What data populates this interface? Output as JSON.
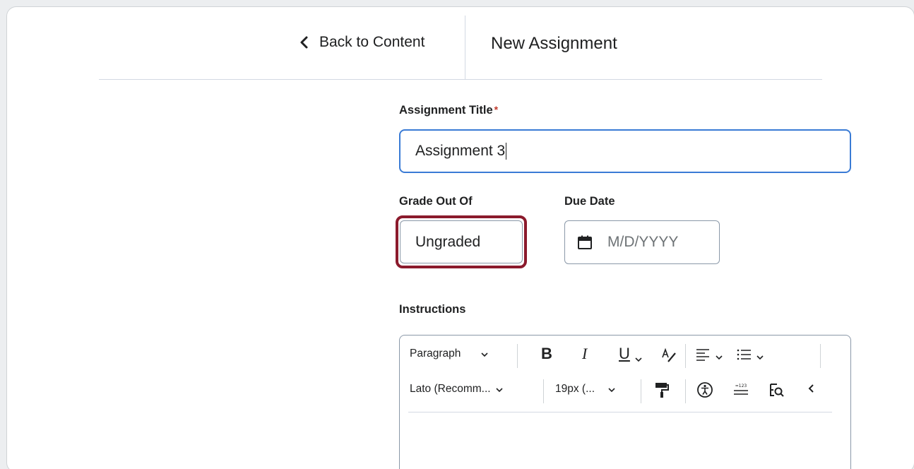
{
  "header": {
    "back_label": "Back to Content",
    "title": "New Assignment"
  },
  "form": {
    "title_label": "Assignment Title",
    "required_mark": "*",
    "title_value": "Assignment 3",
    "grade_label": "Grade Out Of",
    "grade_value": "Ungraded",
    "due_label": "Due Date",
    "due_placeholder": "M/D/YYYY",
    "instructions_label": "Instructions"
  },
  "editor": {
    "paragraph_select": "Paragraph",
    "font_select": "Lato (Recomm...",
    "size_select": "19px (...",
    "bold": "B",
    "italic": "I",
    "underline": "U"
  },
  "colors": {
    "focus_blue": "#3a7bd5",
    "highlight_red": "#8b1a2c"
  }
}
